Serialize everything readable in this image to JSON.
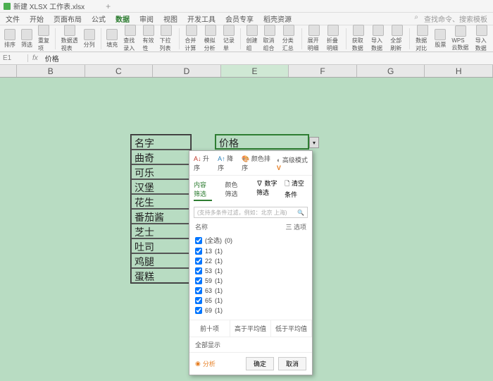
{
  "titlebar": {
    "filename": "新建 XLSX 工作表.xlsx"
  },
  "menu": {
    "items": [
      "文件",
      "开始",
      "页面布局",
      "公式",
      "数据",
      "审阅",
      "视图",
      "开发工具",
      "会员专享",
      "稻壳资源"
    ],
    "active_index": 4,
    "search_placeholder": "查找命令、搜索模板"
  },
  "toolbar": {
    "groups": [
      [
        "排序",
        "筛选",
        "重复项"
      ],
      [
        "数据透视表",
        "分列"
      ],
      [
        "填充",
        "查找录入",
        "有效性",
        "下拉列表"
      ],
      [
        "合并计算",
        "模拟分析",
        "记录单"
      ],
      [
        "创建组",
        "取消组合",
        "分类汇总"
      ],
      [
        "展开明细",
        "折叠明细"
      ],
      [
        "获取数据",
        "导入数据",
        "全部刷新"
      ],
      [
        "数据对比",
        "股票",
        "WPS云数据",
        "导入数据"
      ]
    ]
  },
  "formula": {
    "cell_ref": "E1",
    "fx": "fx",
    "value": "价格"
  },
  "columns": [
    "B",
    "C",
    "D",
    "E",
    "F",
    "G",
    "H"
  ],
  "active_col": "E",
  "data_column": {
    "header": "名字",
    "rows": [
      "曲奇",
      "可乐",
      "汉堡",
      "花生",
      "番茄酱",
      "芝士",
      "吐司",
      "鸡腿",
      "蛋糕"
    ]
  },
  "active_cell_value": "价格",
  "filter": {
    "top": {
      "asc": "升序",
      "desc": "降序",
      "color": "颜色排序",
      "mode": "高级模式"
    },
    "tabs": {
      "content": "内容筛选",
      "color": "颜色筛选",
      "number": "数字筛选",
      "clear": "清空条件"
    },
    "search_placeholder": "(支持多条件过滤，例如：北京 上海)",
    "list_header": {
      "name": "名称",
      "options": "三 选项"
    },
    "items": [
      {
        "label": "(全选)",
        "count": "(0)"
      },
      {
        "label": "13",
        "count": "(1)"
      },
      {
        "label": "22",
        "count": "(1)"
      },
      {
        "label": "53",
        "count": "(1)"
      },
      {
        "label": "59",
        "count": "(1)"
      },
      {
        "label": "63",
        "count": "(1)"
      },
      {
        "label": "65",
        "count": "(1)"
      },
      {
        "label": "69",
        "count": "(1)"
      }
    ],
    "btns3": [
      "前十项",
      "高于平均值",
      "低于平均值"
    ],
    "more": "全部显示",
    "analysis": "分析",
    "ok": "确定",
    "cancel": "取消"
  }
}
